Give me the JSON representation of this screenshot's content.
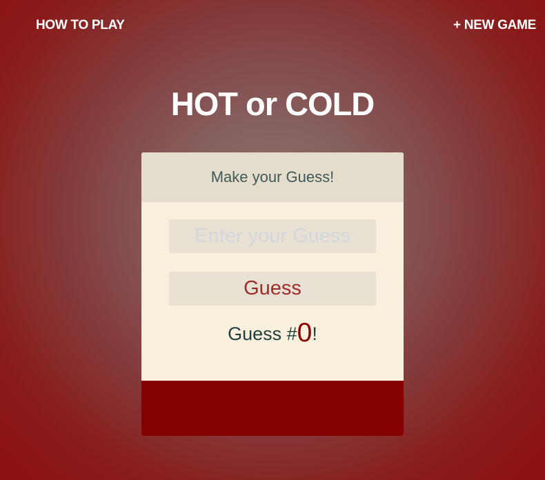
{
  "nav": {
    "how_to_play": "HOW TO PLAY",
    "new_game": "+ NEW GAME"
  },
  "title": "HOT or COLD",
  "card": {
    "header": "Make your Guess!",
    "input_placeholder": "Enter your Guess",
    "button_label": "Guess",
    "count_prefix": "Guess #",
    "count_value": "0",
    "count_suffix": "!",
    "feedback": ""
  },
  "colors": {
    "background_center": "#8d7373",
    "background_edge": "#8b0f0f",
    "header_bg": "#e4ddcb",
    "card_bg": "#f8efdd",
    "feedback_bg": "#850000",
    "button_text": "#9b2d2a",
    "count_value": "#8b0000"
  }
}
